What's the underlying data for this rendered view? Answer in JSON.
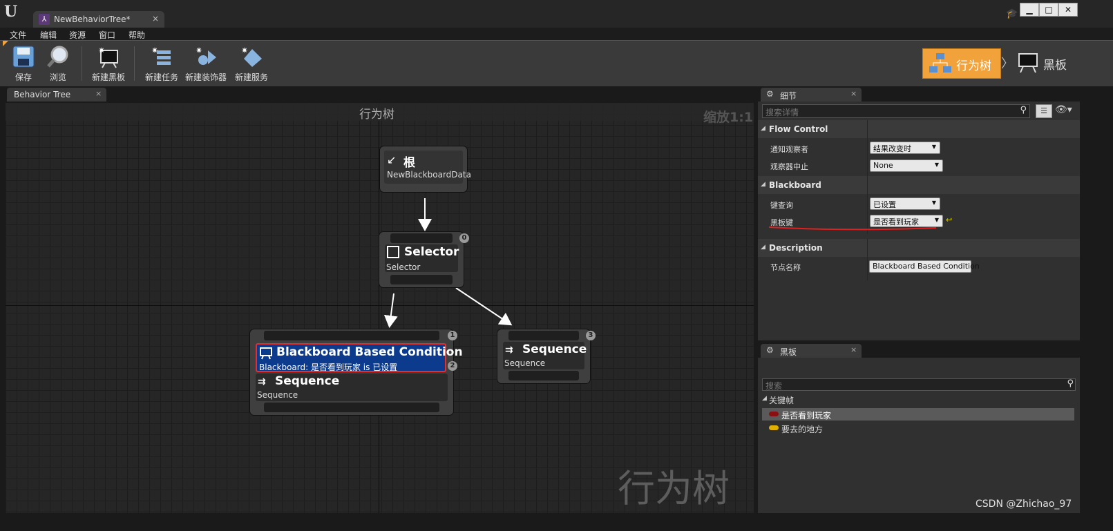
{
  "window": {
    "tab_title": "NewBehaviorTree*",
    "tab_close": "×",
    "logo": "U",
    "controls": [
      "▁",
      "□",
      "✕"
    ]
  },
  "menu": [
    "文件",
    "编辑",
    "资源",
    "窗口",
    "帮助"
  ],
  "toolbar": {
    "buttons": [
      {
        "label": "保存",
        "icon": "save-icon"
      },
      {
        "label": "浏览",
        "icon": "browse-icon"
      },
      {
        "label": "新建黑板",
        "icon": "new-blackboard-icon"
      },
      {
        "label": "新建任务",
        "icon": "new-task-icon"
      },
      {
        "label": "新建装饰器",
        "icon": "new-decorator-icon"
      },
      {
        "label": "新建服务",
        "icon": "new-service-icon"
      }
    ],
    "mode_behavior_tree": "行为树",
    "mode_blackboard": "黑板",
    "mode_separator": "〉",
    "active_mode_color": "#f2a23a"
  },
  "graph": {
    "tab_label": "Behavior Tree",
    "tab_close": "×",
    "header_title": "行为树",
    "zoom": "缩放1:1",
    "watermark": "行为树",
    "nodes": {
      "root": {
        "title": "根",
        "subtitle": "NewBlackboardData"
      },
      "selector": {
        "title": "Selector",
        "subtitle": "Selector",
        "index": "0"
      },
      "sequence_left": {
        "title": "Sequence",
        "subtitle": "Sequence",
        "index": "1"
      },
      "decorator": {
        "title": "Blackboard Based Condition",
        "subtitle": "Blackboard: 是否看到玩家 is 已设置",
        "index": "2",
        "color": "#0c3a8c"
      },
      "sequence_right": {
        "title": "Sequence",
        "subtitle": "Sequence",
        "index": "3"
      }
    }
  },
  "details": {
    "tab_label": "细节",
    "tab_close": "×",
    "search_placeholder": "搜索详情",
    "categories": [
      {
        "name": "Flow Control",
        "props": [
          {
            "label": "通知观察者",
            "value": "结果改变时"
          },
          {
            "label": "观察器中止",
            "value": "None"
          }
        ]
      },
      {
        "name": "Blackboard",
        "props": [
          {
            "label": "键查询",
            "value": "已设置"
          },
          {
            "label": "黑板键",
            "value": "是否看到玩家"
          }
        ]
      },
      {
        "name": "Description",
        "props": [
          {
            "label": "节点名称",
            "value": "Blackboard Based Condition"
          }
        ]
      }
    ]
  },
  "blackboard": {
    "tab_label": "黑板",
    "tab_close": "×",
    "search_placeholder": "搜索",
    "section": "关键帧",
    "keys": [
      {
        "name": "是否看到玩家",
        "color": "#8a1010"
      },
      {
        "name": "要去的地方",
        "color": "#e0b000"
      }
    ]
  },
  "watermark_credit": "CSDN @Zhichao_97"
}
